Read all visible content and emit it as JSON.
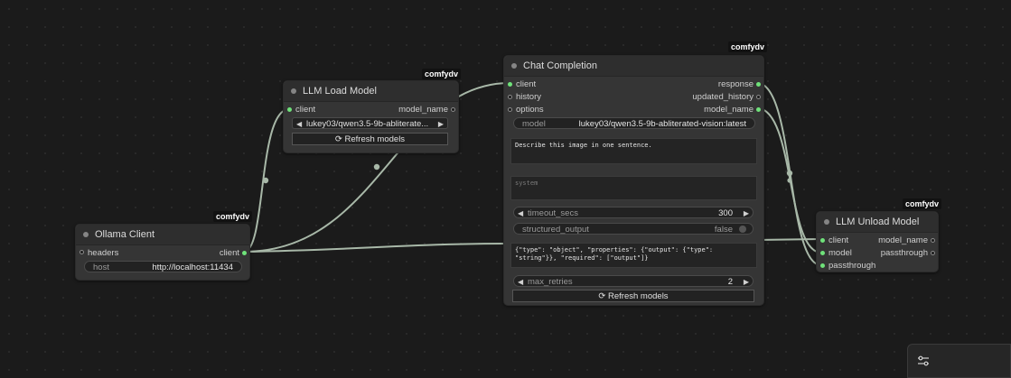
{
  "nodes": {
    "ollama_client": {
      "badge": "comfydv",
      "title": "Ollama Client",
      "inputs": [
        "headers"
      ],
      "outputs": [
        "client"
      ],
      "widgets": {
        "host_label": "host",
        "host_value": "http://localhost:11434"
      }
    },
    "llm_load_model": {
      "badge": "comfydv",
      "title": "LLM Load Model",
      "inputs": [
        "client"
      ],
      "outputs": [
        "model_name"
      ],
      "widgets": {
        "model_value": "lukey03/qwen3.5-9b-abliterate...",
        "refresh_label": "⟳ Refresh models"
      }
    },
    "chat_completion": {
      "badge": "comfydv",
      "title": "Chat Completion",
      "inputs": [
        "client",
        "history",
        "options"
      ],
      "outputs": [
        "response",
        "updated_history",
        "model_name"
      ],
      "widgets": {
        "model_label": "model",
        "model_value": "lukey03/qwen3.5-9b-abliterated-vision:latest",
        "prompt_text": "Describe this image in one sentence.",
        "system_placeholder": "system",
        "timeout_label": "timeout_secs",
        "timeout_value": "300",
        "structured_label": "structured_output",
        "structured_value": "false",
        "schema_text": "{\"type\": \"object\", \"properties\": {\"output\": {\"type\": \"string\"}}, \"required\": [\"output\"]}",
        "retries_label": "max_retries",
        "retries_value": "2",
        "refresh_label": "⟳ Refresh models"
      }
    },
    "llm_unload_model": {
      "badge": "comfydv",
      "title": "LLM Unload Model",
      "inputs": [
        "client",
        "model",
        "passthrough"
      ],
      "outputs": [
        "model_name",
        "passthrough"
      ]
    }
  },
  "icons": {
    "arrow_left": "◀",
    "arrow_right": "▶",
    "settings": "sliders-icon"
  },
  "colors": {
    "canvas": "#1b1b1b",
    "node_body": "#353535",
    "node_title": "#2e2e2e",
    "socket_connected": "#6fe27a",
    "wire": "#a8b8a8"
  }
}
